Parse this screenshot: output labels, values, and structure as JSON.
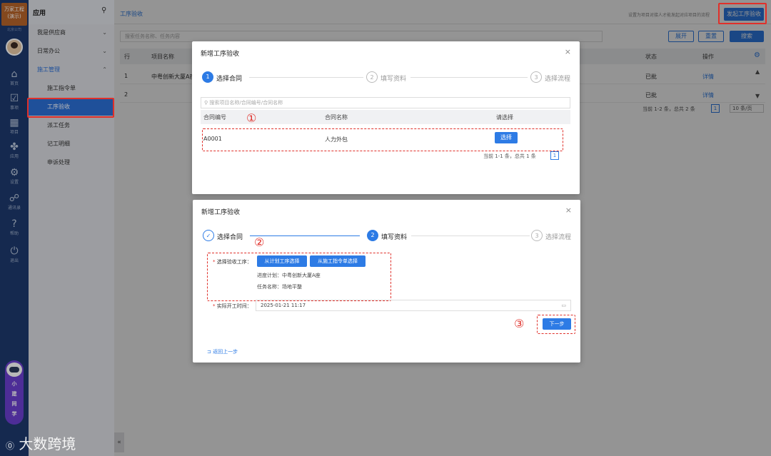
{
  "brand": {
    "name": "万家工程",
    "sub": "(演示)",
    "company": "北京公司"
  },
  "rail": [
    {
      "icon": "home-icon",
      "label": "首页",
      "glyph": "⌂"
    },
    {
      "icon": "task-icon",
      "label": "事项",
      "glyph": "☑"
    },
    {
      "icon": "project-icon",
      "label": "项目",
      "glyph": "▦"
    },
    {
      "icon": "apps-icon",
      "label": "应用",
      "glyph": "✤"
    },
    {
      "icon": "settings-icon",
      "label": "设置",
      "glyph": "⚙"
    },
    {
      "icon": "contacts-icon",
      "label": "通讯录",
      "glyph": "☍"
    },
    {
      "icon": "help-icon",
      "label": "帮助",
      "glyph": "?"
    },
    {
      "icon": "logout-icon",
      "label": "退出",
      "glyph": "⏻"
    }
  ],
  "assistant": {
    "name_chars": [
      "小",
      "建",
      "同",
      "学"
    ]
  },
  "watermark": "大数跨境",
  "sidebar": {
    "title": "应用",
    "groups": [
      {
        "label": "我是供应商",
        "chev": "⌄"
      },
      {
        "label": "日常办公",
        "chev": "⌄"
      },
      {
        "label": "施工管理",
        "chev": "⌃"
      }
    ],
    "items": [
      "施工指令单",
      "工序验收",
      "派工任务",
      "记工明细",
      "申诉处理"
    ]
  },
  "main": {
    "tab": "工序验收",
    "hint": "设置为项目对接人才能发起对应项目的流程",
    "start_button": "发起工序验收",
    "search_placeholder": "搜索任务名称、任务内容",
    "expand_button": "展开",
    "reset_button": "重置",
    "search_button": "搜索",
    "columns": {
      "row": "行",
      "project": "项目名称",
      "status": "状态",
      "op": "操作"
    },
    "rows": [
      {
        "row": "1",
        "project": "中粤创新大厦A座",
        "status": "已批",
        "op": "详情"
      },
      {
        "row": "2",
        "project": "",
        "status": "已批",
        "op": "详情"
      }
    ],
    "pagination": {
      "summary": "当前 1-2 条，总共 2 条",
      "page": "1",
      "size": "10 条/页"
    }
  },
  "modal1": {
    "title": "新增工序验收",
    "steps": [
      "选择合同",
      "填写资料",
      "选择流程"
    ],
    "search_placeholder": "搜索项目名称/合同编号/合同名称",
    "columns": {
      "code": "合同编号",
      "name": "合同名称",
      "choose": "请选择"
    },
    "rows": [
      {
        "code": "A0001",
        "name": "人力外包",
        "choose": "选择"
      }
    ],
    "pagination": {
      "summary": "当前 1-1 条，总共 1 条",
      "page": "1"
    }
  },
  "modal2": {
    "title": "新增工序验收",
    "steps": [
      "选择合同",
      "填写资料",
      "选择流程"
    ],
    "select_label": "选择验收工序：",
    "btn_plan": "从计划工序选择",
    "btn_order": "从施工指令单选择",
    "progress_plan": "进度计划：中粤创新大厦A座",
    "task_name": "任务名称：场地平整",
    "start_time_label": "实际开工时间：",
    "start_time_value": "2025-01-21 11:17",
    "next_button": "下一步",
    "back_link": "返回上一步"
  },
  "markers": [
    "①",
    "②",
    "③"
  ],
  "colors": {
    "accent": "#2d7be5",
    "annotation": "#e0302a",
    "rail": "#1e3a6e"
  }
}
